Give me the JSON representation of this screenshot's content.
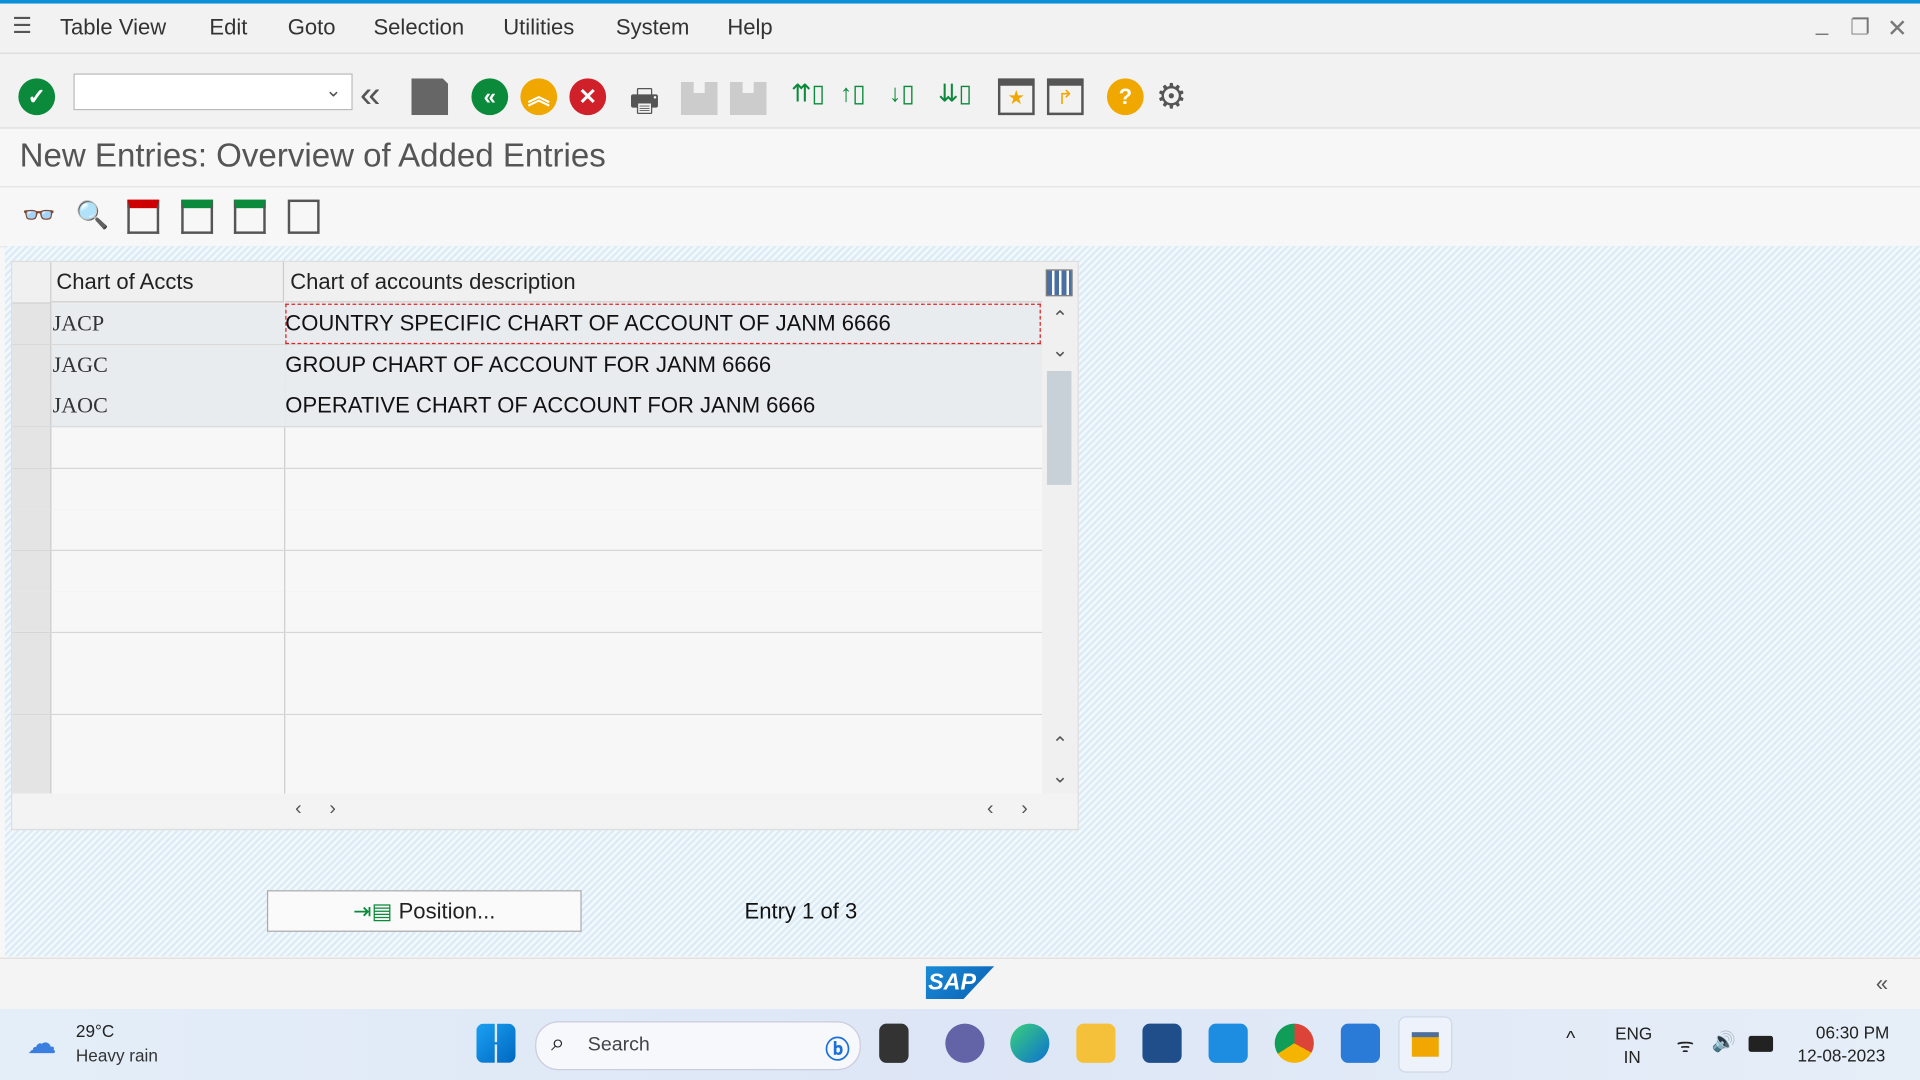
{
  "menubar": {
    "items": [
      "Table View",
      "Edit",
      "Goto",
      "Selection",
      "Utilities",
      "System",
      "Help"
    ]
  },
  "toolbar": {
    "command_field": {
      "value": "",
      "placeholder": ""
    }
  },
  "page": {
    "title": "New Entries: Overview of Added Entries"
  },
  "table": {
    "columns": [
      "Chart of Accts",
      "Chart of accounts description"
    ],
    "rows": [
      {
        "code": "JACP",
        "description": "COUNTRY SPECIFIC CHART OF ACCOUNT OF JANM 6666"
      },
      {
        "code": "JAGC",
        "description": "GROUP CHART OF ACCOUNT FOR JANM 6666"
      },
      {
        "code": "JAOC",
        "description": "OPERATIVE CHART OF ACCOUNT FOR JANM 6666"
      }
    ]
  },
  "footer": {
    "position_button": "Position...",
    "entry_info": "Entry 1 of 3",
    "logo": "SAP"
  },
  "taskbar": {
    "weather_temp": "29°C",
    "weather_desc": "Heavy rain",
    "search_placeholder": "Search",
    "lang": "ENG",
    "region": "IN",
    "time": "06:30 PM",
    "date": "12-08-2023"
  },
  "colors": {
    "accent": "#0a8fd8",
    "green": "#0a8a3a",
    "orange": "#f0a800",
    "red": "#d0202a"
  }
}
